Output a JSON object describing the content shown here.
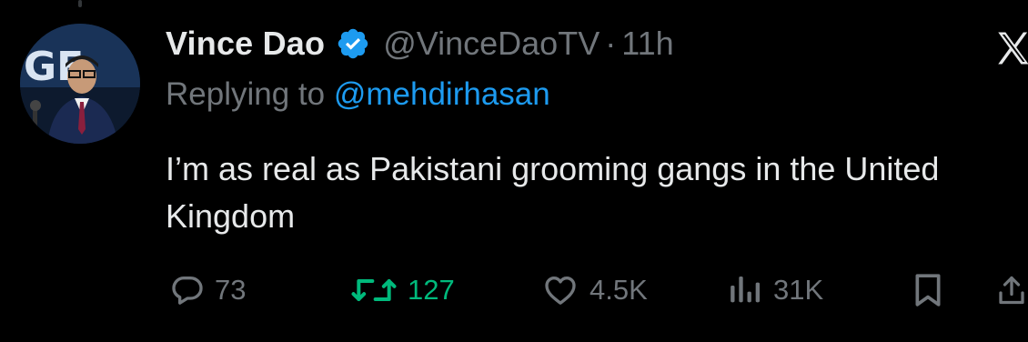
{
  "tweet": {
    "display_name": "Vince Dao",
    "handle": "@VinceDaoTV",
    "separator": "·",
    "time": "11h",
    "replying_prefix": "Replying to",
    "replying_to": "@mehdirhasan",
    "text": "I’m as real as Pakistani grooming gangs in the United Kingdom",
    "avatar_text": "GE"
  },
  "actions": {
    "replies": "73",
    "retweets": "127",
    "likes": "4.5K",
    "views": "31K"
  },
  "icons": {
    "verified": "verified-badge-icon",
    "platform": "x-logo-icon",
    "reply": "reply-bubble-icon",
    "retweet": "retweet-arrows-icon",
    "like": "heart-icon",
    "views": "bar-chart-icon",
    "bookmark": "bookmark-icon",
    "share": "share-upload-icon"
  },
  "colors": {
    "background": "#000000",
    "text_primary": "#e7e9ea",
    "text_secondary": "#71767b",
    "link": "#1d9bf0",
    "verified": "#1d9bf0",
    "retweeted": "#00ba7c"
  }
}
